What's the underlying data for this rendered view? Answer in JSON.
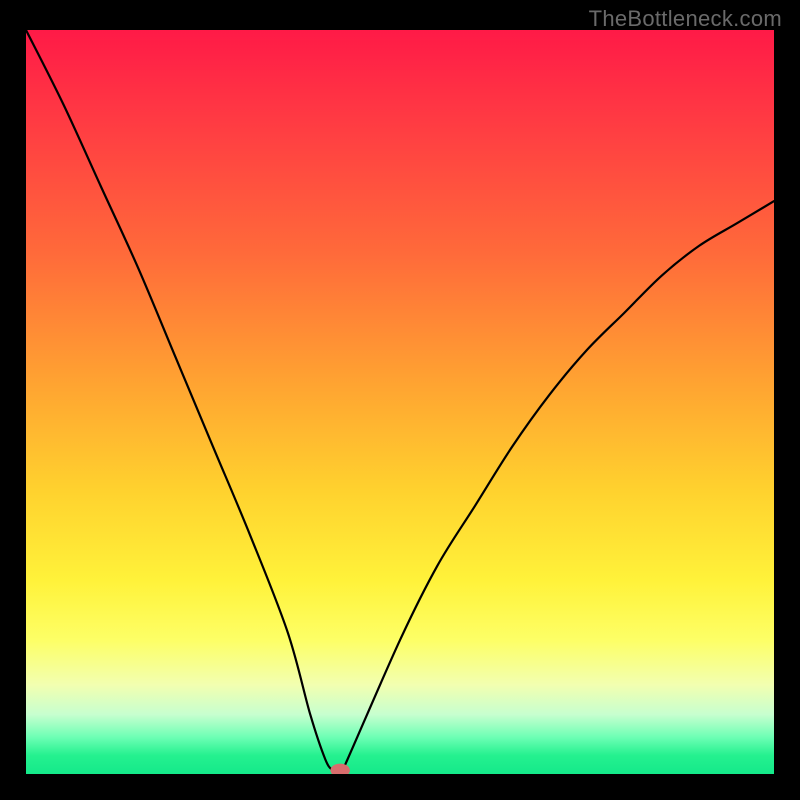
{
  "watermark": "TheBottleneck.com",
  "colors": {
    "gradient_top": "#ff1a47",
    "gradient_mid": "#ffd22e",
    "gradient_bottom": "#14e98a",
    "curve": "#000000",
    "marker": "#d86d6d",
    "frame": "#000000"
  },
  "chart_data": {
    "type": "line",
    "title": "",
    "xlabel": "",
    "ylabel": "",
    "xlim": [
      0,
      100
    ],
    "ylim": [
      0,
      100
    ],
    "grid": false,
    "legend": false,
    "x": [
      0,
      5,
      10,
      15,
      20,
      25,
      30,
      35,
      38,
      40,
      41,
      42,
      43,
      50,
      55,
      60,
      65,
      70,
      75,
      80,
      85,
      90,
      95,
      100
    ],
    "values": [
      100,
      90,
      79,
      68,
      56,
      44,
      32,
      19,
      8,
      2,
      0.5,
      0,
      2,
      18,
      28,
      36,
      44,
      51,
      57,
      62,
      67,
      71,
      74,
      77
    ],
    "marker": {
      "x": 42,
      "y": 0
    },
    "note": "V-shaped bottleneck/mismatch curve; minimum (0%) near x≈42; values read from gradient position as approximate percentages"
  }
}
